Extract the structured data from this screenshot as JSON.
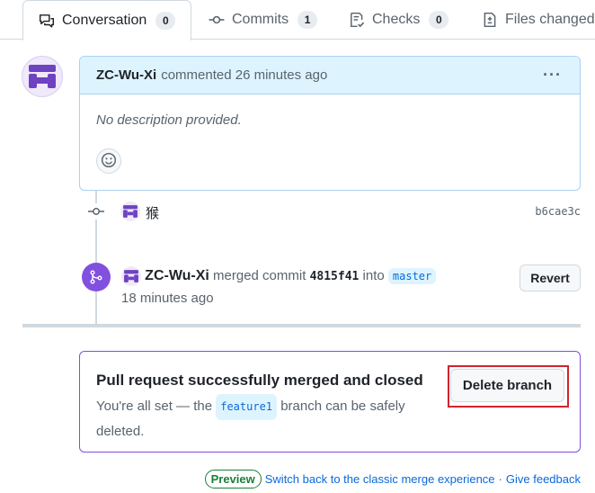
{
  "tabs": [
    {
      "label": "Conversation",
      "count": "0",
      "icon": "comment-discussion-icon"
    },
    {
      "label": "Commits",
      "count": "1",
      "icon": "git-commit-icon"
    },
    {
      "label": "Checks",
      "count": "0",
      "icon": "checklist-icon"
    },
    {
      "label": "Files changed",
      "icon": "file-diff-icon"
    }
  ],
  "comment": {
    "author": "ZC-Wu-Xi",
    "action": "commented 26 minutes ago",
    "menu": "···",
    "body": "No description provided."
  },
  "commit": {
    "message": "猴",
    "sha": "b6cae3c"
  },
  "merge_event": {
    "author": "ZC-Wu-Xi",
    "text_merged": "merged commit",
    "sha": "4815f41",
    "text_into": "into",
    "branch": "master",
    "time": "18 minutes ago",
    "revert_label": "Revert"
  },
  "merged_box": {
    "title": "Pull request successfully merged and closed",
    "desc_before": "You're all set — the",
    "branch": "feature1",
    "desc_after": "branch can be safely deleted.",
    "delete_label": "Delete branch"
  },
  "footer": {
    "preview": "Preview",
    "switch_link": "Switch back to the classic merge experience",
    "separator": "·",
    "feedback_link": "Give feedback"
  },
  "colors": {
    "accent_purple": "#8250df",
    "link_blue": "#0969da",
    "header_blue": "#ddf4ff",
    "highlight_red": "#d1242f",
    "preview_green": "#1a7f37"
  }
}
